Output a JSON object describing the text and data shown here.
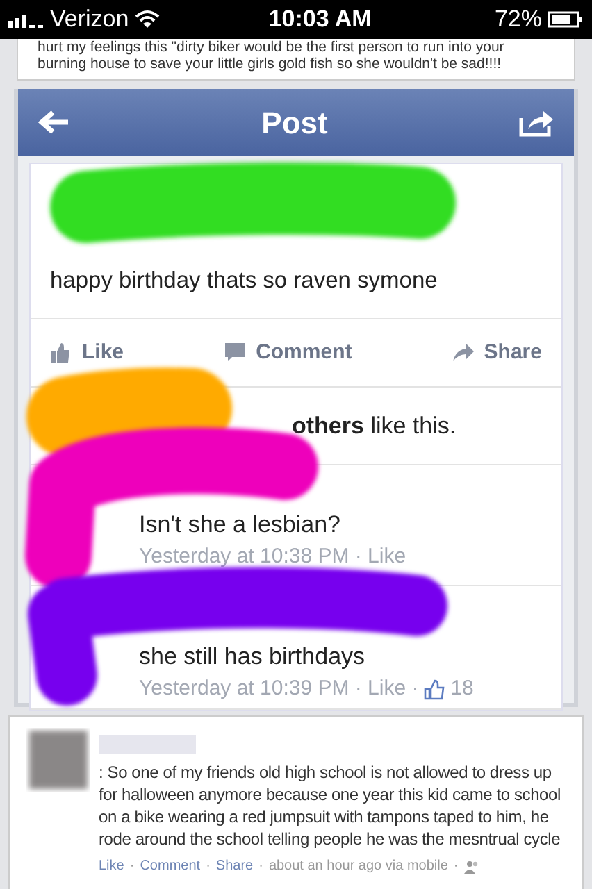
{
  "status_bar": {
    "carrier": "Verizon",
    "time": "10:03 AM",
    "battery": "72%"
  },
  "previous_post_text": "hurt my feelings this \"dirty biker would be the first person to run into your burning house to save your little girls gold fish so she wouldn't be sad!!!!",
  "nav_bar": {
    "title": "Post"
  },
  "post": {
    "text": "happy birthday thats so raven symone",
    "actions": [
      {
        "label": "Like",
        "kind": "like"
      },
      {
        "label": "Comment",
        "kind": "comment"
      },
      {
        "label": "Share",
        "kind": "share"
      }
    ],
    "likes_summary": "**others** like this.",
    "comments": [
      {
        "text": "Isn't she a lesbian?",
        "meta": "Yesterday at 10:38 PM · Like"
      },
      {
        "text": "she still has birthdays",
        "meta": "Yesterday at 10:39 PM · Like ·",
        "like_count": "18"
      }
    ]
  },
  "redactions": [
    {
      "color": "#33dd22"
    },
    {
      "color": "#ffaa00"
    },
    {
      "color": "#ee00bb"
    },
    {
      "color": "#7700ee"
    }
  ],
  "story": {
    "text": ": So one of my friends old high school is not allowed to dress up for halloween anymore because one year this kid came to school on a bike wearing a red jumpsuit with tampons taped to him, he rode around the school telling people he was the mesntrual cycle",
    "footer": [
      {
        "text": "Like",
        "kind": "link"
      },
      {
        "text": "·",
        "kind": "separator"
      },
      {
        "text": "Comment",
        "kind": "link"
      },
      {
        "text": "·",
        "kind": "separator"
      },
      {
        "text": "Share",
        "kind": "link"
      },
      {
        "text": "·",
        "kind": "separator"
      },
      {
        "text": "about an hour ago via mobile",
        "kind": "meta"
      },
      {
        "text": "·",
        "kind": "separator"
      }
    ]
  }
}
